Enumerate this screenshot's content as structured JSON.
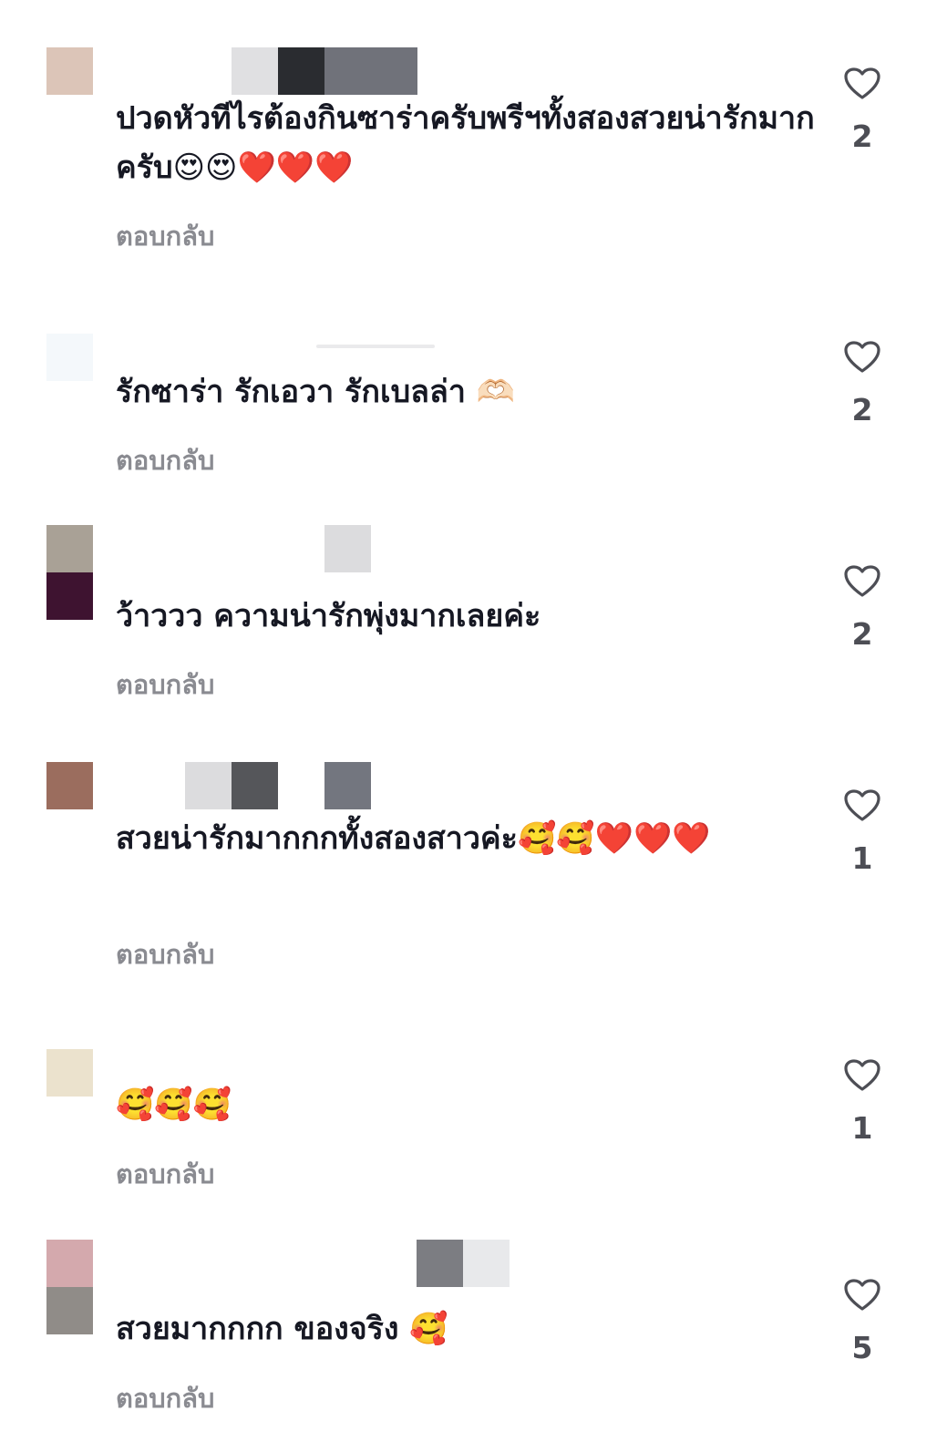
{
  "colors": {
    "text": "#161823",
    "reply": "#8a8b91",
    "count": "#4d4e55",
    "heart_outline": "#4d4e55"
  },
  "reply_label": "ตอบกลับ",
  "icons": {
    "like": "heart-outline-icon"
  },
  "comments": [
    {
      "text": "ปวดหัวทีไรต้องกินซาร่าครับพรีฯทั้งสองสวยน่ารักมากครับ😍😍❤️❤️❤️",
      "likes": "2",
      "avatar_colors": [
        "#dcc5b8"
      ],
      "username_blocks": [
        "#e0e0e2",
        "#2a2c30",
        "#70727a"
      ]
    },
    {
      "text": "รักซาร่า รักเอวา รักเบลล่า 🫶🏻",
      "likes": "2",
      "avatar_colors": [
        "#f4f8fb"
      ],
      "username_blocks": []
    },
    {
      "text": "ว้าววว ความน่ารักพุ่งมากเลยค่ะ",
      "likes": "2",
      "avatar_colors": [
        "#a9a196",
        "#3e1330"
      ],
      "username_blocks": [
        "#dcdcde"
      ]
    },
    {
      "text": "สวยน่ารักมากกกทั้งสองสาวค่ะ🥰🥰❤️❤️❤️",
      "likes": "1",
      "avatar_colors": [
        "#9b6d5e"
      ],
      "username_blocks": [
        "#dcdcde",
        "#55565a",
        "#73767f"
      ]
    },
    {
      "text": "🥰🥰🥰",
      "likes": "1",
      "avatar_colors": [
        "#ebe2cd"
      ],
      "username_blocks": []
    },
    {
      "text": "สวยมากกกก ของจริง 🥰",
      "likes": "5",
      "avatar_colors": [
        "#d4a9ad",
        "#908c88"
      ],
      "username_blocks": [
        "#7c7d82",
        "#e8e9eb"
      ]
    }
  ]
}
